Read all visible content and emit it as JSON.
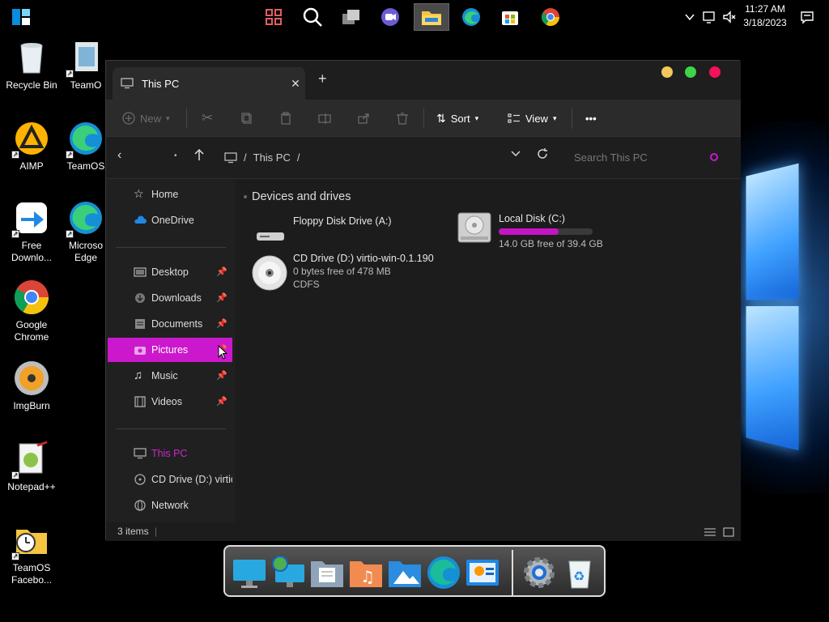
{
  "taskbar": {
    "icons": [
      "start-icon",
      "widgets-icon",
      "search-icon",
      "task-view-icon",
      "chat-icon",
      "file-explorer-icon",
      "edge-icon",
      "store-icon",
      "chrome-icon"
    ],
    "clock_time": "11:27 AM",
    "clock_date": "3/18/2023"
  },
  "desktop": {
    "icons": [
      {
        "label": "Recycle Bin"
      },
      {
        "label": "TeamO"
      },
      {
        "label": "AIMP"
      },
      {
        "label": "TeamOS"
      },
      {
        "label": "Free Downlo..."
      },
      {
        "label": "Microso Edge"
      },
      {
        "label": "Google Chrome"
      },
      {
        "label": "ImgBurn"
      },
      {
        "label": "Notepad++"
      },
      {
        "label": "TeamOS Facebo..."
      }
    ]
  },
  "explorer": {
    "tab_title": "This PC",
    "new_tab": "+",
    "tab_close": "✕",
    "toolbar": {
      "new_label": "New",
      "sort_label": "Sort",
      "view_label": "View",
      "more_label": "•••"
    },
    "address": {
      "crumb_sep": "/",
      "crumb_label": "This PC",
      "search_placeholder": "Search This PC"
    },
    "sidebar": {
      "items": [
        {
          "label": "Home"
        },
        {
          "label": "OneDrive"
        },
        {
          "label": "Desktop"
        },
        {
          "label": "Downloads"
        },
        {
          "label": "Documents"
        },
        {
          "label": "Pictures"
        },
        {
          "label": "Music"
        },
        {
          "label": "Videos"
        },
        {
          "label": "This PC"
        },
        {
          "label": "CD Drive (D:) virtio-"
        },
        {
          "label": "Network"
        }
      ]
    },
    "content": {
      "group_title": "Devices and drives",
      "drives": [
        {
          "name": "Floppy Disk Drive (A:)"
        },
        {
          "name": "Local Disk (C:)",
          "free_text": "14.0 GB free of 39.4 GB",
          "used_fraction": 0.64
        },
        {
          "name": "CD Drive (D:) virtio-win-0.1.190",
          "free_text": "0 bytes free of 478 MB",
          "fs": "CDFS"
        }
      ]
    },
    "status": {
      "items_count": "3 items"
    }
  },
  "colors": {
    "accent": "#cc18cc",
    "window_bg": "#1c1c1c",
    "traffic_yellow": "#f2c75c",
    "traffic_green": "#3fd34a",
    "traffic_red": "#f2125a"
  },
  "dock": {
    "icons": [
      "monitor-icon",
      "network-icon",
      "documents-folder-icon",
      "music-folder-icon",
      "pictures-folder-icon",
      "edge-icon",
      "control-panel-icon",
      "settings-gear-icon",
      "recycle-bin-icon"
    ]
  }
}
